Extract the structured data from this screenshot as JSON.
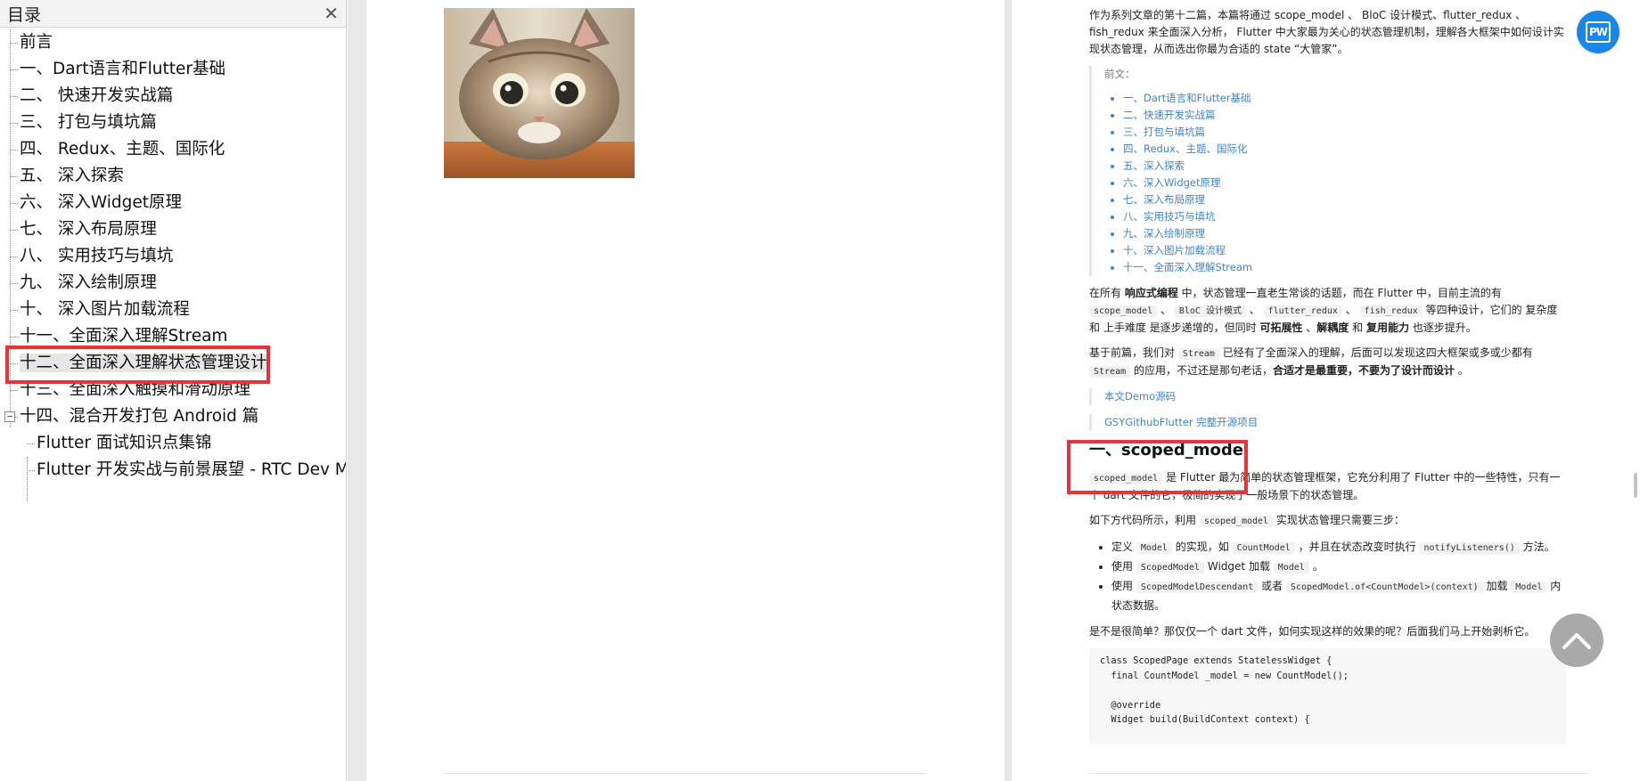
{
  "sidebar": {
    "title": "目录",
    "close_glyph": "✕",
    "toggle_glyph": "−",
    "items": [
      {
        "label": "前言"
      },
      {
        "label": "一、Dart语言和Flutter基础"
      },
      {
        "label": "二、 快速开发实战篇"
      },
      {
        "label": "三、 打包与填坑篇"
      },
      {
        "label": "四、 Redux、主题、国际化"
      },
      {
        "label": "五、 深入探索"
      },
      {
        "label": "六、 深入Widget原理"
      },
      {
        "label": "七、 深入布局原理"
      },
      {
        "label": "八、 实用技巧与填坑"
      },
      {
        "label": "九、 深入绘制原理"
      },
      {
        "label": "十、 深入图片加载流程"
      },
      {
        "label": "十一、全面深入理解Stream"
      },
      {
        "label": "十二、全面深入理解状态管理设计",
        "selected": true
      },
      {
        "label": "十三、全面深入触摸和滑动原理"
      },
      {
        "label": "十四、混合开发打包 Android 篇",
        "expanded": true
      },
      {
        "label": "Flutter 面试知识点集锦",
        "level": 2
      },
      {
        "label": "Flutter 开发实战与前景展望 - RTC Dev Meetup",
        "level": 2
      }
    ]
  },
  "article": {
    "intro": "作为系列文章的第十二篇，本篇将通过 scope_model 、 BloC 设计模式、flutter_redux 、fish_redux 来全面深入分析， Flutter 中大家最为关心的状态管理机制，理解各大框架中如何设计实现状态管理，从而选出你最为合适的 state “大管家”。",
    "prev_title": "前文：",
    "prev_links": [
      "一、Dart语言和Flutter基础",
      "二、快速开发实战篇",
      "三、打包与填坑篇",
      "四、Redux、主题、国际化",
      "五、深入探索",
      "六、深入Widget原理",
      "七、深入布局原理",
      "八、实用技巧与填坑",
      "九、深入绘制原理",
      "十、深入图片加载流程",
      "十一、全面深入理解Stream"
    ],
    "p1": {
      "a": "在所有 ",
      "b": "响应式编程",
      "c": " 中，状态管理一直老生常谈的话题，而在 Flutter 中，目前主流的有 ",
      "code1": "scope_model",
      "sep1": " 、 ",
      "code2": "BloC 设计模式",
      "sep2": " 、 ",
      "code3": "flutter_redux",
      "sep3": " 、 ",
      "code4": "fish_redux",
      "d": " 等四种设计，它们的 复杂度 和 上手难度 是逐步递增的，但同时 ",
      "e": "可拓展性",
      "f": " 、",
      "g": "解耦度",
      "h": " 和 ",
      "i": "复用能力",
      "j": " 也逐步提升。"
    },
    "p2": {
      "a": "基于前篇，我们对 ",
      "code1": "Stream",
      "b": " 已经有了全面深入的理解，后面可以发现这四大框架或多或少都有 ",
      "code2": "Stream",
      "c": " 的应用，不过还是那句老话，",
      "d": "合适才是最重要，不要为了设计而设计",
      "e": " 。"
    },
    "link1": "本文Demo源码",
    "link2": "GSYGithubFlutter 完整开源项目",
    "heading": "一、scoped_model",
    "p3": {
      "code1": "scoped_model",
      "a": " 是 Flutter 最为简单的状态管理框架，它充分利用了 Flutter 中的一些特性，只有一个 dart 文件的它，极简的实现了一般场景下的状态管理。"
    },
    "p4": {
      "a": "如下方代码所示，利用 ",
      "code1": "scoped_model",
      "b": " 实现状态管理只需要三步："
    },
    "steps": {
      "s1": {
        "a": "定义 ",
        "code1": "Model",
        "b": " 的实现，如 ",
        "code2": "CountModel",
        "c": " ，并且在状态改变时执行 ",
        "code3": "notifyListeners()",
        "d": " 方法。"
      },
      "s2": {
        "a": "使用 ",
        "code1": "ScopedModel",
        "b": " Widget 加载 ",
        "code2": "Model",
        "c": " 。"
      },
      "s3": {
        "a": "使用 ",
        "code1": "ScopedModelDescendant",
        "b": " 或者 ",
        "code2": "ScopedModel.of<CountModel>(context)",
        "c": " 加载 ",
        "code3": "Model",
        "d": " 内状态数据。"
      }
    },
    "p5": "是不是很简单？那仅仅一个 dart 文件，如何实现这样的效果的呢？后面我们马上开始剥析它。",
    "code_lines": [
      "class ScopedPage extends StatelessWidget {",
      "  final CountModel _model = new CountModel();",
      "",
      "  @override",
      "  Widget build(BuildContext context) {"
    ]
  },
  "floating": {
    "pw_label": "PW",
    "scroll_top_icon": "chevron-up-icon"
  }
}
